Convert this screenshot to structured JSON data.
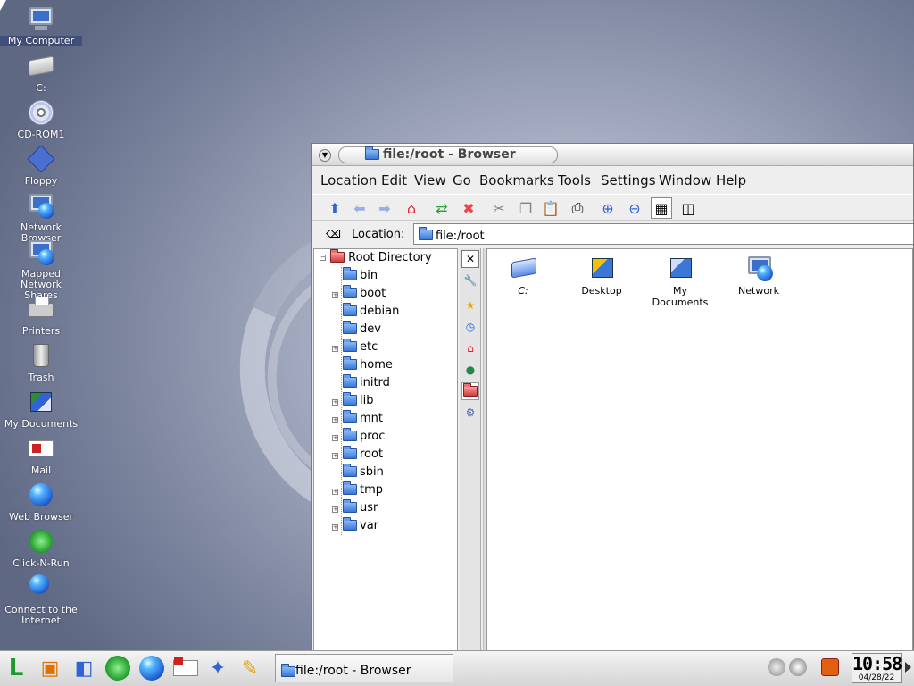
{
  "desktop": {
    "icons": [
      {
        "label": "My Computer",
        "icon": "computer-icon"
      },
      {
        "label": "C:",
        "icon": "hard-drive-icon"
      },
      {
        "label": "CD-ROM1",
        "icon": "cdrom-icon"
      },
      {
        "label": "Floppy",
        "icon": "floppy-icon"
      },
      {
        "label": "Network Browser",
        "icon": "network-browser-icon"
      },
      {
        "label": "Mapped Network",
        "label2": "Shares",
        "icon": "mapped-network-icon"
      },
      {
        "label": "Printers",
        "icon": "printer-icon"
      },
      {
        "label": "Trash",
        "icon": "trash-icon"
      },
      {
        "label": "My Documents",
        "icon": "documents-icon"
      },
      {
        "label": "Mail",
        "icon": "mail-icon"
      },
      {
        "label": "Web Browser",
        "icon": "globe-icon"
      },
      {
        "label": "Click-N-Run",
        "icon": "runner-icon"
      },
      {
        "label": "Connect to the",
        "label2": "Internet",
        "icon": "connect-icon"
      }
    ]
  },
  "window": {
    "title": "file:/root - Browser",
    "menu": [
      "Location",
      "Edit",
      "View",
      "Go",
      "Bookmarks",
      "Tools",
      "Settings",
      "Window",
      "Help"
    ],
    "location_label": "Location:",
    "location_value": "file:/root",
    "tree": {
      "root": "Root Directory",
      "items": [
        {
          "name": "bin",
          "expandable": false
        },
        {
          "name": "boot",
          "expandable": true
        },
        {
          "name": "debian",
          "expandable": false
        },
        {
          "name": "dev",
          "expandable": false
        },
        {
          "name": "etc",
          "expandable": true
        },
        {
          "name": "home",
          "expandable": false
        },
        {
          "name": "initrd",
          "expandable": false
        },
        {
          "name": "lib",
          "expandable": true
        },
        {
          "name": "mnt",
          "expandable": true
        },
        {
          "name": "proc",
          "expandable": true
        },
        {
          "name": "root",
          "expandable": true
        },
        {
          "name": "sbin",
          "expandable": false
        },
        {
          "name": "tmp",
          "expandable": true
        },
        {
          "name": "usr",
          "expandable": true
        },
        {
          "name": "var",
          "expandable": true
        }
      ]
    },
    "files": [
      {
        "name": "C:",
        "icon": "drive-link-icon"
      },
      {
        "name": "Desktop",
        "icon": "desktop-folder-icon"
      },
      {
        "name": "My Documents",
        "icon": "documents-folder-icon"
      },
      {
        "name": "Network",
        "icon": "network-icon"
      }
    ]
  },
  "taskbar": {
    "task_label": "file:/root - Browser",
    "clock_time": "10:58",
    "clock_date": "04/28/22"
  },
  "colors": {
    "accent": "#3b77d6",
    "desktop_bg": "#7d869f"
  }
}
